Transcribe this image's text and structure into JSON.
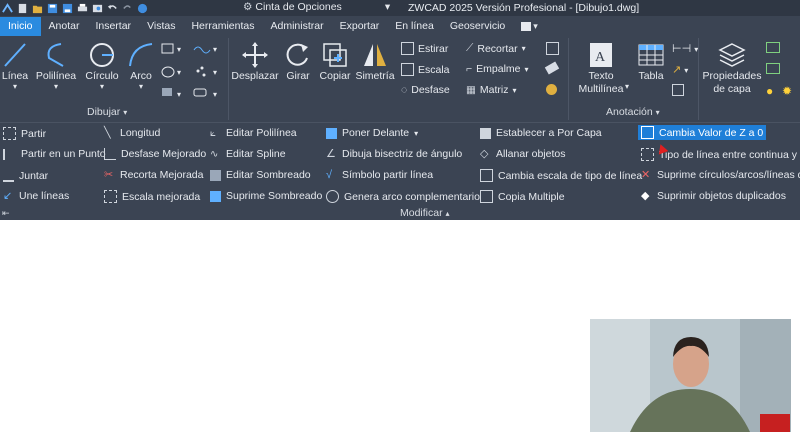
{
  "title_bar": {
    "window_title": "ZWCAD 2025 Versión Profesional - [Dibujo1.dwg]",
    "ribbon_option": "Cinta de Opciones"
  },
  "tabs": [
    "Inicio",
    "Anotar",
    "Insertar",
    "Vistas",
    "Herramientas",
    "Administrar",
    "Exportar",
    "En línea",
    "Geoservicio"
  ],
  "draw_panel": {
    "label": "Dibujar",
    "big_buttons": [
      "Línea",
      "Polilínea",
      "Círculo",
      "Arco"
    ]
  },
  "modify_top": {
    "big_buttons": [
      "Desplazar",
      "Girar",
      "Copiar",
      "Simetría"
    ],
    "small_col1": [
      "Estirar",
      "Escala",
      "Desfase"
    ],
    "small_col2": [
      "Recortar",
      "Empalme",
      "Matriz"
    ]
  },
  "annotation_panel": {
    "label": "Anotación",
    "buttons": [
      "Texto Multilínea",
      "Tabla"
    ]
  },
  "properties": {
    "label": "Propiedades de capa"
  },
  "modify_panel": {
    "label": "Modificar",
    "col1": [
      "Partir",
      "Partir en un Punto",
      "Juntar",
      "Une líneas"
    ],
    "col2": [
      "Longitud",
      "Desfase Mejorado",
      "Recorta Mejorada",
      "Escala mejorada"
    ],
    "col3": [
      "Editar Polilínea",
      "Editar Spline",
      "Editar Sombreado",
      "Suprime Sombreado"
    ],
    "col4": [
      "Poner Delante",
      "Dibuja bisectriz de ángulo",
      "Símbolo partir línea",
      "Genera arco complementario"
    ],
    "col5": [
      "Establecer a Por Capa",
      "Allanar objetos",
      "Cambia escala de tipo de línea",
      "Copia Multiple"
    ],
    "col6": [
      "Cambia Valor de Z a 0",
      "Tipo de línea entre continua y p",
      "Suprime círculos/arcos/líneas du",
      "Suprimir objetos duplicados"
    ]
  },
  "colors": {
    "ribbon_bg": "#3b4453",
    "accent": "#2a8be0",
    "highlight": "#1f7fd8"
  }
}
